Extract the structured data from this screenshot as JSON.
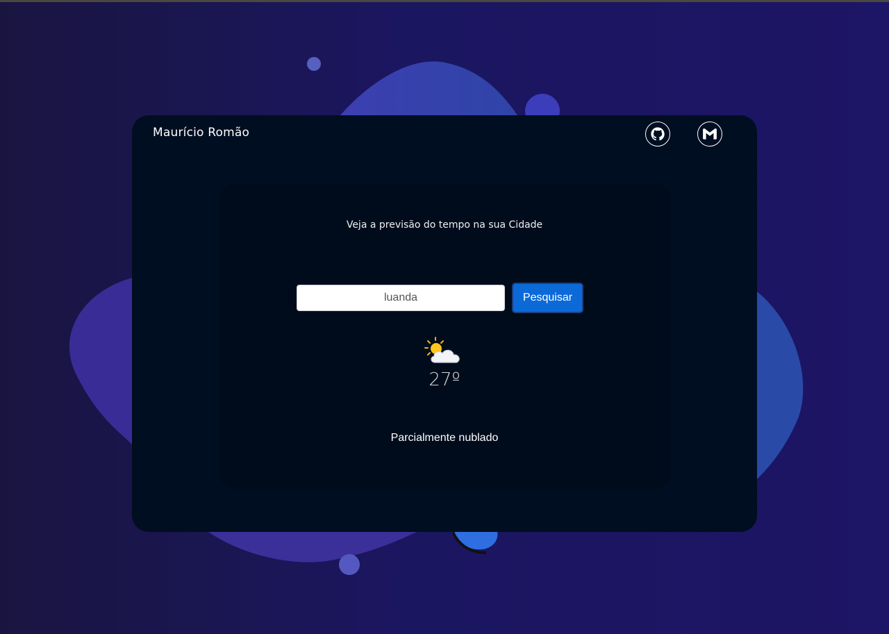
{
  "header": {
    "brand": "Maurício Romão",
    "links": [
      {
        "name": "github",
        "icon": "github-icon"
      },
      {
        "name": "gmail",
        "icon": "gmail-icon"
      }
    ]
  },
  "main": {
    "prompt": "Veja a previsão do tempo na sua Cidade",
    "search": {
      "value": "luanda",
      "button_label": "Pesquisar"
    },
    "weather": {
      "icon": "partly-cloudy-icon",
      "temperature": "27º",
      "description": "Parcialmente nublado"
    }
  },
  "colors": {
    "background": "#1b1660",
    "card": "#000e21",
    "accent_button": "#0b6ad8"
  }
}
